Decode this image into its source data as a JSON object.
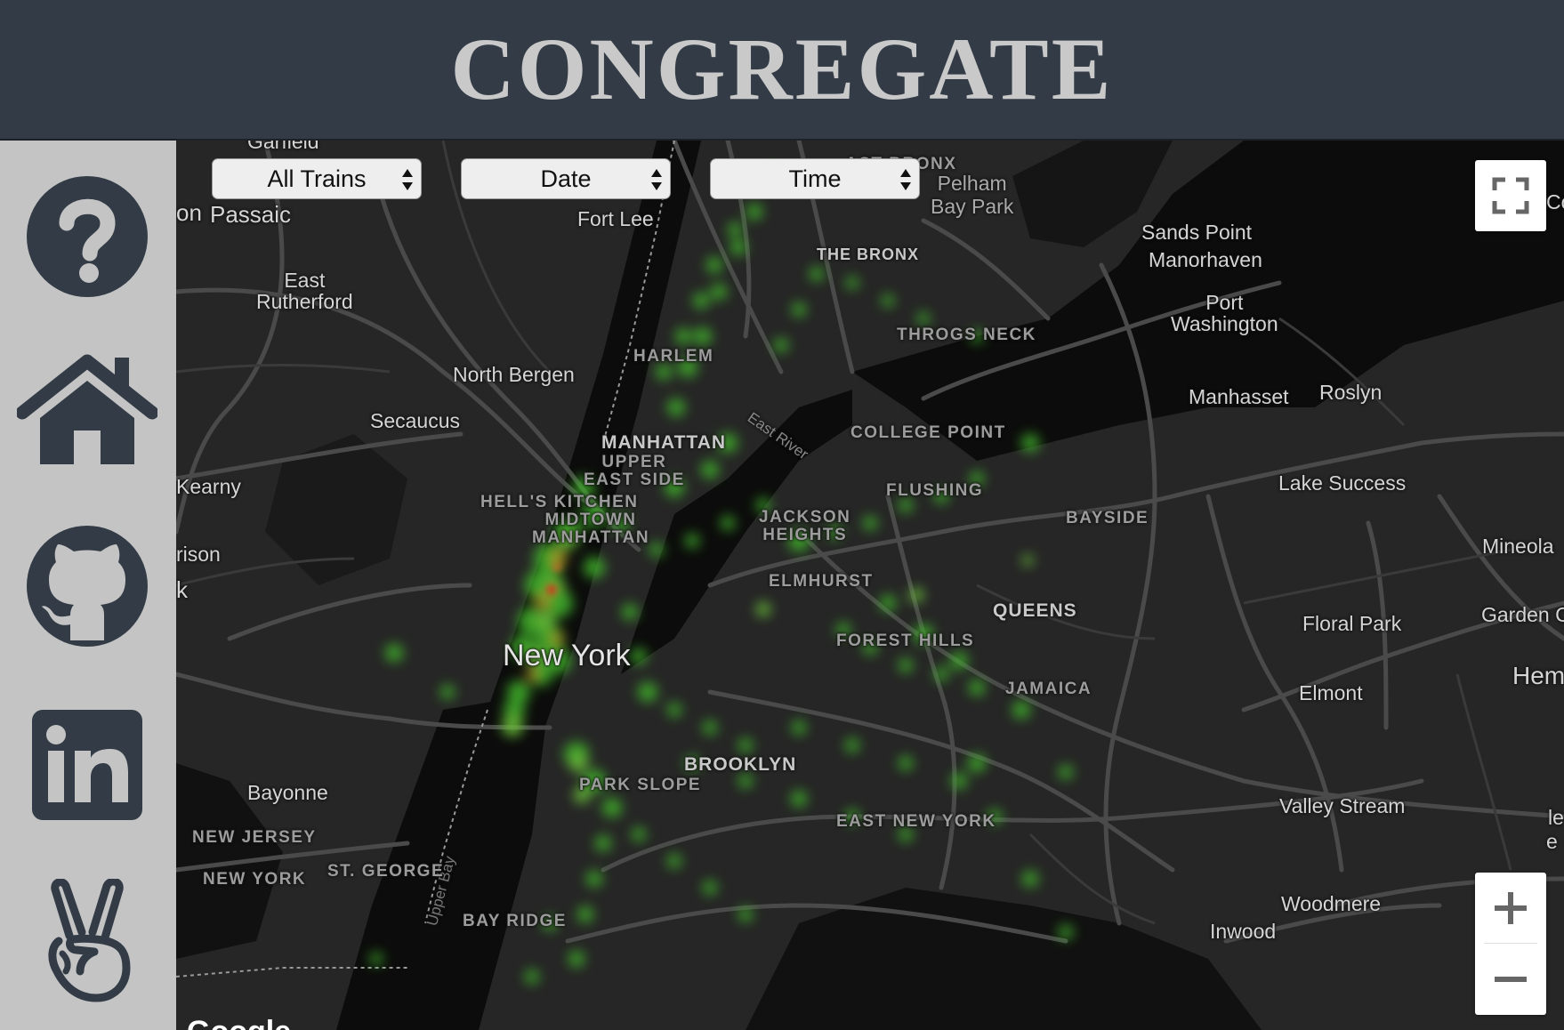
{
  "app": {
    "title": "CONGREGATE"
  },
  "sidebar": {
    "items": [
      {
        "icon": "question-circle-icon"
      },
      {
        "icon": "home-icon"
      },
      {
        "icon": "github-icon"
      },
      {
        "icon": "linkedin-icon"
      },
      {
        "icon": "angellist-icon"
      }
    ]
  },
  "filters": {
    "trains": "All Trains",
    "date": "Date",
    "time": "Time"
  },
  "map": {
    "fullscreen_icon": "fullscreen-icon",
    "zoom_in_icon": "plus-icon",
    "zoom_out_icon": "minus-icon",
    "attribution": "Google",
    "labels": {
      "garfield": "Garfield",
      "passaic": "Passaic",
      "on": "on",
      "fort_lee": "Fort Lee",
      "east_bronx": "AST BRONX",
      "pelham_bay_park": "Pelham\nBay Park",
      "co": "Co",
      "sands_point": "Sands Point",
      "manorhaven": "Manorhaven",
      "the_bronx": "THE BRONX",
      "east_rutherford": "East\nRutherford",
      "port_washington": "Port\nWashington",
      "throgs_neck": "THROGS NECK",
      "harlem": "HARLEM",
      "north_bergen": "North Bergen",
      "manhasset": "Manhasset",
      "roslyn": "Roslyn",
      "secaucus": "Secaucus",
      "east_river": "East River",
      "college_point": "COLLEGE POINT",
      "manhattan": "MANHATTAN",
      "upper_east_side": "UPPER\nEAST SIDE",
      "kearny": "Kearny",
      "flushing": "FLUSHING",
      "lake_success": "Lake Success",
      "hells_kitchen": "HELL'S KITCHEN",
      "midtown_manhattan": "MIDTOWN\nMANHATTAN",
      "jackson_heights": "JACKSON\nHEIGHTS",
      "bayside": "BAYSIDE",
      "rison": "rison",
      "mineola": "Mineola",
      "k": "k",
      "elmhurst": "ELMHURST",
      "queens": "QUEENS",
      "floral_park": "Floral Park",
      "garden_c": "Garden C",
      "forest_hills": "FOREST HILLS",
      "new_york": "New York",
      "jamaica": "JAMAICA",
      "hem": "Hem",
      "elmont": "Elmont",
      "brooklyn": "BROOKLYN",
      "bayonne": "Bayonne",
      "park_slope": "PARK SLOPE",
      "valley_stream": "Valley Stream",
      "east_new_york": "EAST NEW YORK",
      "new_jersey": "NEW JERSEY",
      "upper_bay": "Upper Bay",
      "new_york_state": "NEW YORK",
      "st_george": "ST. GEORGE",
      "woodmere": "Woodmere",
      "bay_ridge": "BAY RIDGE",
      "inwood": "Inwood",
      "le": "le",
      "e": "e"
    }
  }
}
